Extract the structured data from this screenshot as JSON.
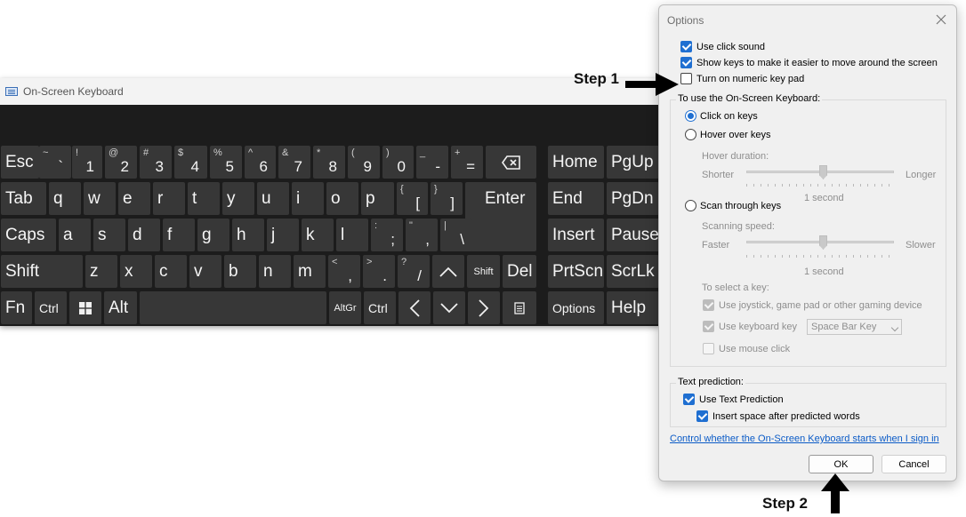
{
  "keyboard": {
    "title": "On-Screen Keyboard",
    "rows": [
      [
        {
          "id": "esc",
          "label": "Esc"
        },
        {
          "id": "tilde",
          "sub": "~",
          "main": "`"
        },
        {
          "id": "1",
          "sub": "!",
          "main": "1"
        },
        {
          "id": "2",
          "sub": "@",
          "main": "2"
        },
        {
          "id": "3",
          "sub": "#",
          "main": "3"
        },
        {
          "id": "4",
          "sub": "$",
          "main": "4"
        },
        {
          "id": "5",
          "sub": "%",
          "main": "5"
        },
        {
          "id": "6",
          "sub": "^",
          "main": "6"
        },
        {
          "id": "7",
          "sub": "&",
          "main": "7"
        },
        {
          "id": "8",
          "sub": "*",
          "main": "8"
        },
        {
          "id": "9",
          "sub": "(",
          "main": "9"
        },
        {
          "id": "0",
          "sub": ")",
          "main": "0"
        },
        {
          "id": "minus",
          "sub": "_",
          "main": "-"
        },
        {
          "id": "equals",
          "sub": "+",
          "main": "="
        },
        {
          "id": "backspace",
          "icon": "backspace-icon"
        },
        {
          "id": "home",
          "label": "Home"
        },
        {
          "id": "pgup",
          "label": "PgUp"
        }
      ],
      [
        {
          "id": "tab",
          "label": "Tab"
        },
        {
          "id": "q",
          "label": "q"
        },
        {
          "id": "w",
          "label": "w"
        },
        {
          "id": "e",
          "label": "e"
        },
        {
          "id": "r",
          "label": "r"
        },
        {
          "id": "t",
          "label": "t"
        },
        {
          "id": "y",
          "label": "y"
        },
        {
          "id": "u",
          "label": "u"
        },
        {
          "id": "i",
          "label": "i"
        },
        {
          "id": "o",
          "label": "o"
        },
        {
          "id": "p",
          "label": "p"
        },
        {
          "id": "lbracket",
          "sub": "{",
          "main": "["
        },
        {
          "id": "rbracket",
          "sub": "}",
          "main": "]"
        },
        {
          "id": "enter",
          "label": "Enter"
        },
        {
          "id": "end",
          "label": "End"
        },
        {
          "id": "pgdn",
          "label": "PgDn"
        }
      ],
      [
        {
          "id": "caps",
          "label": "Caps"
        },
        {
          "id": "a",
          "label": "a"
        },
        {
          "id": "s",
          "label": "s"
        },
        {
          "id": "d",
          "label": "d"
        },
        {
          "id": "f",
          "label": "f"
        },
        {
          "id": "g",
          "label": "g"
        },
        {
          "id": "h",
          "label": "h"
        },
        {
          "id": "j",
          "label": "j"
        },
        {
          "id": "k",
          "label": "k"
        },
        {
          "id": "l",
          "label": "l"
        },
        {
          "id": "semicolon",
          "sub": ":",
          "main": ";"
        },
        {
          "id": "quote",
          "sub": "\"",
          "main": ","
        },
        {
          "id": "backslash",
          "sub": "|",
          "main": "\\"
        },
        {
          "id": "insert",
          "label": "Insert"
        },
        {
          "id": "pause",
          "label": "Pause"
        }
      ],
      [
        {
          "id": "shift-left",
          "label": "Shift"
        },
        {
          "id": "z",
          "label": "z"
        },
        {
          "id": "x",
          "label": "x"
        },
        {
          "id": "c",
          "label": "c"
        },
        {
          "id": "v",
          "label": "v"
        },
        {
          "id": "b",
          "label": "b"
        },
        {
          "id": "n",
          "label": "n"
        },
        {
          "id": "m",
          "label": "m"
        },
        {
          "id": "comma",
          "sub": "<",
          "main": ","
        },
        {
          "id": "period",
          "sub": ">",
          "main": "."
        },
        {
          "id": "slash",
          "sub": "?",
          "main": "/"
        },
        {
          "id": "up",
          "icon": "arrow-up-icon"
        },
        {
          "id": "shift-right",
          "label": "Shift"
        },
        {
          "id": "del",
          "label": "Del"
        },
        {
          "id": "prtscn",
          "label": "PrtScn"
        },
        {
          "id": "scrlk",
          "label": "ScrLk"
        }
      ],
      [
        {
          "id": "fn",
          "label": "Fn"
        },
        {
          "id": "ctrl-left",
          "label": "Ctrl"
        },
        {
          "id": "win",
          "icon": "windows-icon"
        },
        {
          "id": "alt",
          "label": "Alt"
        },
        {
          "id": "space",
          "label": ""
        },
        {
          "id": "altgr",
          "label": "AltGr"
        },
        {
          "id": "ctrl-right",
          "label": "Ctrl"
        },
        {
          "id": "left",
          "icon": "arrow-left-icon"
        },
        {
          "id": "down",
          "icon": "arrow-down-icon"
        },
        {
          "id": "right",
          "icon": "arrow-right-icon"
        },
        {
          "id": "menu",
          "icon": "menu-key-icon"
        },
        {
          "id": "options",
          "label": "Options"
        },
        {
          "id": "help",
          "label": "Help"
        }
      ]
    ]
  },
  "options_dialog": {
    "title": "Options",
    "use_click_sound": {
      "label": "Use click sound",
      "checked": true
    },
    "show_keys": {
      "label": "Show keys to make it easier to move around the screen",
      "checked": true
    },
    "numeric_keypad": {
      "label": "Turn on numeric key pad",
      "checked": false
    },
    "use_osk_group": {
      "title": "To use the On-Screen Keyboard:",
      "click_on_keys": "Click on keys",
      "hover_over_keys": "Hover over keys",
      "hover_duration_label": "Hover duration:",
      "hover_shorter": "Shorter",
      "hover_longer": "Longer",
      "hover_value": "1 second",
      "scan_through_keys": "Scan through keys",
      "scanning_speed_label": "Scanning speed:",
      "scan_faster": "Faster",
      "scan_slower": "Slower",
      "scan_value": "1 second",
      "select_key_label": "To select a key:",
      "use_joystick": "Use joystick, game pad or other gaming device",
      "use_keyboard_key": "Use keyboard key",
      "keyboard_key_value": "Space Bar Key",
      "use_mouse_click": "Use mouse click"
    },
    "text_prediction_group": {
      "title": "Text prediction:",
      "use_text_prediction": {
        "label": "Use Text Prediction",
        "checked": true
      },
      "insert_space": {
        "label": "Insert space after predicted words",
        "checked": true
      }
    },
    "startup_link": "Control whether the On-Screen Keyboard starts when I sign in",
    "ok_label": "OK",
    "cancel_label": "Cancel"
  },
  "annotations": {
    "step1": "Step 1",
    "step2": "Step 2"
  },
  "colors": {
    "keyboard_bg": "#1c1c1c",
    "key_bg": "#373737",
    "accent": "#1f6fd1",
    "link": "#0b5bc7"
  }
}
